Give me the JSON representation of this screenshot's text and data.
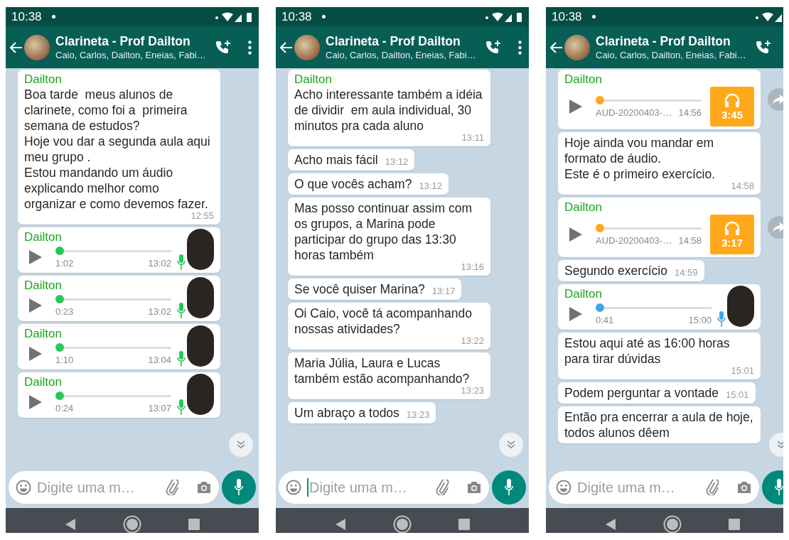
{
  "phones": [
    {
      "status_bar": {
        "time": "10:38"
      },
      "header": {
        "title": "Clarineta - Prof Dailton",
        "subtitle": "Caio, Carlos, Dailton, Eneias, Fabi…"
      },
      "messages": [
        {
          "kind": "text",
          "sender": "Dailton",
          "body": "Boa tarde  meus alunos de clarinete, como foi a  primeira semana de estudos?\nHoje vou dar a segunda aula aqui meu grupo .\nEstou mandando um áudio explicando melhor como organizar e como devemos fazer.",
          "time": "12:55"
        },
        {
          "kind": "voice",
          "sender": "Dailton",
          "duration": "1:02",
          "time": "13:02",
          "played": false
        },
        {
          "kind": "voice",
          "sender": "Dailton",
          "duration": "0:23",
          "time": "13:02",
          "played": false
        },
        {
          "kind": "voice",
          "sender": "Dailton",
          "duration": "1:10",
          "time": "13:04",
          "played": false
        },
        {
          "kind": "voice",
          "sender": "Dailton",
          "duration": "0:24",
          "time": "13:07",
          "played": false
        }
      ],
      "composer": {
        "placeholder": "Digite uma m…",
        "focused": false
      }
    },
    {
      "status_bar": {
        "time": "10:38"
      },
      "header": {
        "title": "Clarineta - Prof Dailton",
        "subtitle": "Caio, Carlos, Dailton, Eneias, Fabi…"
      },
      "messages": [
        {
          "kind": "text",
          "sender": "Dailton",
          "body": "Acho interessante também a idéia de dividir  em aula individual, 30 minutos pra cada aluno",
          "time": "13:11"
        },
        {
          "kind": "text",
          "body": "Acho mais fácil",
          "time": "13:12"
        },
        {
          "kind": "text",
          "body": "O que vocês acham?",
          "time": "13:12"
        },
        {
          "kind": "text",
          "body": "Mas posso continuar assim com os grupos, a Marina pode participar do grupo das 13:30 horas também",
          "time": "13:16"
        },
        {
          "kind": "text",
          "body": "Se você quiser Marina?",
          "time": "13:17"
        },
        {
          "kind": "text",
          "body": "Oi Caio, você tá acompanhando nossas atividades?",
          "time": "13:22"
        },
        {
          "kind": "text",
          "body": "Maria Júlia, Laura e Lucas também estão acompanhando?",
          "time": "13:23"
        },
        {
          "kind": "text",
          "body": "Um abraço a todos",
          "time": "13:23"
        }
      ],
      "composer": {
        "placeholder": "Digite uma m…",
        "focused": true
      }
    },
    {
      "status_bar": {
        "time": "10:38"
      },
      "header": {
        "title": "Clarineta - Prof Dailton",
        "subtitle": "Caio, Carlos, Dailton, Eneias, Fabi…"
      },
      "messages": [
        {
          "kind": "audio_file",
          "sender": "Dailton",
          "filename": "AUD-20200403-…",
          "time": "14:56",
          "duration": "3:45"
        },
        {
          "kind": "text",
          "body": "Hoje ainda vou mandar em formato de áudio.\nEste é o primeiro exercício.",
          "time": "14:58"
        },
        {
          "kind": "audio_file",
          "sender": "Dailton",
          "filename": "AUD-20200403-…",
          "time": "14:58",
          "duration": "3:17"
        },
        {
          "kind": "text",
          "body": "Segundo exercício",
          "time": "14:59"
        },
        {
          "kind": "voice",
          "sender": "Dailton",
          "duration": "0:41",
          "time": "15:00",
          "played": true
        },
        {
          "kind": "text",
          "body": "Estou aqui até as 16:00 horas para tirar dúvidas",
          "time": "15:01"
        },
        {
          "kind": "text",
          "body": "Podem perguntar a vontade",
          "time": "15:01"
        },
        {
          "kind": "text",
          "body": "Então pra encerrar a aula de hoje, todos alunos dêem"
        }
      ],
      "composer": {
        "placeholder": "Digite uma m…",
        "focused": false
      }
    }
  ]
}
